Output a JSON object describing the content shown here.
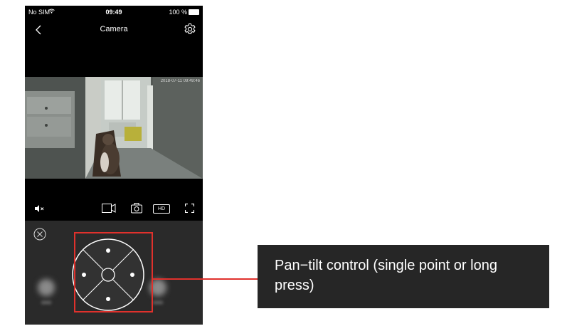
{
  "status_bar": {
    "carrier": "No SIM",
    "time": "09:49",
    "battery": "100 %"
  },
  "nav": {
    "title": "Camera",
    "back_icon": "chevron-left-icon",
    "settings_icon": "gear-icon"
  },
  "video": {
    "watermark": "2018-07-11 09:49:46"
  },
  "toolbar": {
    "mute_icon": "speaker-muted-icon",
    "record_icon": "video-camera-icon",
    "snapshot_icon": "camera-icon",
    "quality_label": "HD",
    "fullscreen_icon": "fullscreen-icon"
  },
  "control_panel": {
    "close_icon": "close-circle-icon",
    "pad_icon": "ptz-direction-pad-icon"
  },
  "callout": {
    "text": "Pan−tilt control (single point or long press)"
  },
  "colors": {
    "highlight": "#e0312c",
    "callout_bg": "#262626",
    "panel_bg": "#2a2a2a"
  }
}
